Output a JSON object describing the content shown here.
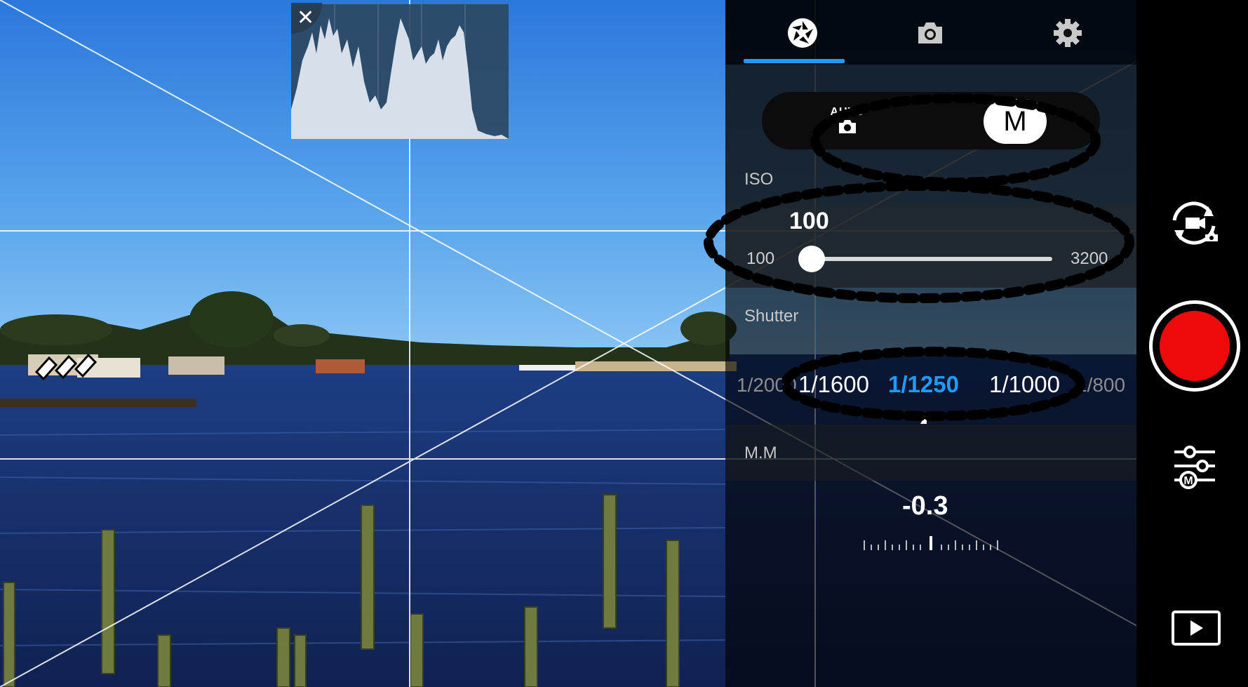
{
  "tabs": [
    {
      "icon": "aperture-icon",
      "active": true
    },
    {
      "icon": "camera-icon",
      "active": false
    },
    {
      "icon": "gear-icon",
      "active": false
    }
  ],
  "mode": {
    "auto_label": "AUTO",
    "manual_label": "M",
    "selected": "M"
  },
  "iso": {
    "label": "ISO",
    "value": "100",
    "min": "100",
    "max": "3200",
    "position": 0
  },
  "shutter": {
    "label": "Shutter",
    "options": [
      "1/2000",
      "1/1600",
      "1/1250",
      "1/1000",
      "1/800"
    ],
    "selected": "1/1250"
  },
  "exposure": {
    "label": "M.M",
    "value": "-0.3"
  },
  "histogram": {
    "close_icon": "close-icon"
  },
  "rail": {
    "switch_icon": "switch-camera-video-icon",
    "record_color": "#ee0a0a",
    "settings_icon": "sliders-m-icon",
    "play_icon": "play-icon"
  },
  "colors": {
    "accent": "#1e9bff",
    "record": "#ee0a0a"
  }
}
